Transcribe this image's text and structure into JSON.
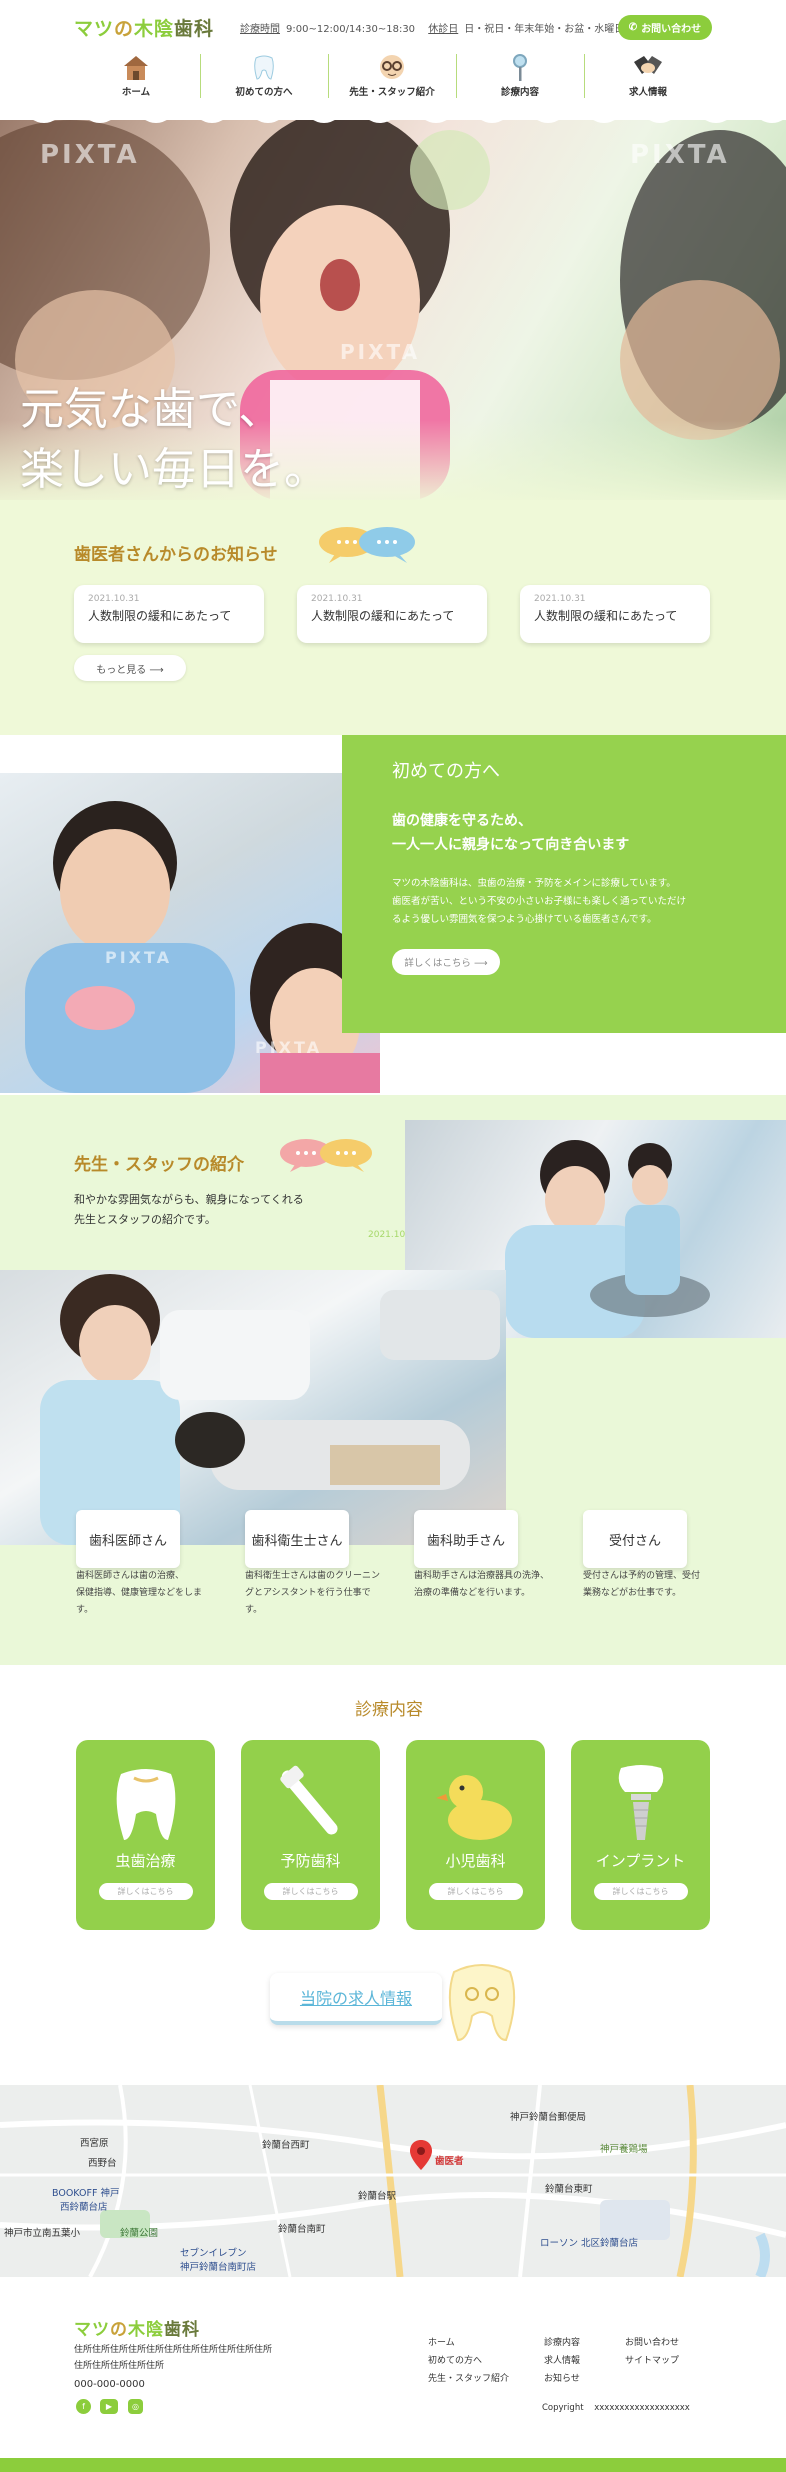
{
  "header": {
    "logo": {
      "part1": "マツ",
      "part2": "の",
      "part3": "木陰",
      "part4": "歯科"
    },
    "hours_label": "診療時間",
    "hours_value": "9:00~12:00/14:30~18:30",
    "closed_label": "休診日",
    "closed_value": "日・祝日・年末年始・お盆・水曜日午後",
    "contact_label": "お問い合わせ",
    "nav": [
      {
        "label": "ホーム",
        "icon": "house-icon"
      },
      {
        "label": "初めての方へ",
        "icon": "tooth-icon"
      },
      {
        "label": "先生・スタッフ紹介",
        "icon": "glasses-face-icon"
      },
      {
        "label": "診療内容",
        "icon": "dental-mirror-icon"
      },
      {
        "label": "求人情報",
        "icon": "handshake-icon"
      }
    ]
  },
  "hero": {
    "line1": "元気な歯で、",
    "line2": "楽しい毎日を。",
    "watermark": "PIXTA"
  },
  "news": {
    "title": "歯医者さんからのお知らせ",
    "items": [
      {
        "date": "2021.10.31",
        "title": "人数制限の緩和にあたって"
      },
      {
        "date": "2021.10.31",
        "title": "人数制限の緩和にあたって"
      },
      {
        "date": "2021.10.31",
        "title": "人数制限の緩和にあたって"
      }
    ],
    "more_label": "もっと見る ⟶"
  },
  "first_visit": {
    "title": "初めての方へ",
    "heading_line1": "歯の健康を守るため、",
    "heading_line2": "一人一人に親身になって向き合います",
    "body_line1": "マツの木陰歯科は、虫歯の治療・予防をメインに診療しています。",
    "body_line2": "歯医者が苦い、という不安の小さいお子様にも楽しく通っていただけ",
    "body_line3": "るよう優しい雰囲気を保つよう心掛けている歯医者さんです。",
    "button_label": "詳しくはこちら ⟶"
  },
  "staff": {
    "title": "先生・スタッフの紹介",
    "desc_line1": "和やかな雰囲気ながらも、親身になってくれる",
    "desc_line2": "先生とスタッフの紹介です。",
    "date_overlay": "2021.10.31",
    "roles": [
      {
        "name": "歯科医師さん",
        "desc1": "歯科医師さんは歯の治療、",
        "desc2": "保健指導、健康管理などをします。"
      },
      {
        "name": "歯科衛生士さん",
        "desc1": "歯科衛生士さんは歯のクリーニン",
        "desc2": "グとアシスタントを行う仕事です。"
      },
      {
        "name": "歯科助手さん",
        "desc1": "歯科助手さんは治療器具の洗浄、",
        "desc2": "治療の準備などを行います。"
      },
      {
        "name": "受付さん",
        "desc1": "受付さんは予約の管理、受付",
        "desc2": "業務などがお仕事です。"
      }
    ]
  },
  "treatment": {
    "title": "診療内容",
    "items": [
      {
        "label": "虫歯治療",
        "button": "詳しくはこちら",
        "icon": "tooth-icon"
      },
      {
        "label": "予防歯科",
        "button": "詳しくはこちら",
        "icon": "toothbrush-icon"
      },
      {
        "label": "小児歯科",
        "button": "詳しくはこちら",
        "icon": "rubber-duck-icon"
      },
      {
        "label": "インプラント",
        "button": "詳しくはこちら",
        "icon": "implant-icon"
      }
    ],
    "recruit_label": "当院の求人情報"
  },
  "map": {
    "labels": [
      "西宮原",
      "西野台",
      "鈴蘭台西町",
      "神戸鈴蘭台郵便局",
      "神戸養鶏場",
      "BOOKOFF 神戸",
      "西鈴蘭台店",
      "鈴蘭台駅",
      "歯医者",
      "鈴蘭公園",
      "神戸市立南五葉小",
      "セブンイレブン",
      "神戸鈴蘭台南町店",
      "ローソン 北区鈴蘭台店",
      "鈴蘭台東町",
      "鈴蘭台南町"
    ]
  },
  "footer": {
    "logo": {
      "part1": "マツ",
      "part2": "の",
      "part3": "木陰",
      "part4": "歯科"
    },
    "addr_line1": "住所住所住所住所住所住所住所住所住所住所住所",
    "addr_line2": "住所住所住所住所住所",
    "tel": "000-000-0000",
    "col1": [
      "ホーム",
      "初めての方へ",
      "先生・スタッフ紹介"
    ],
    "col2": [
      "診療内容",
      "求人情報",
      "お知らせ"
    ],
    "col3": [
      "お問い合わせ",
      "サイトマップ"
    ],
    "copyright_label": "Copyright",
    "copyright_value": "xxxxxxxxxxxxxxxxxxx"
  }
}
